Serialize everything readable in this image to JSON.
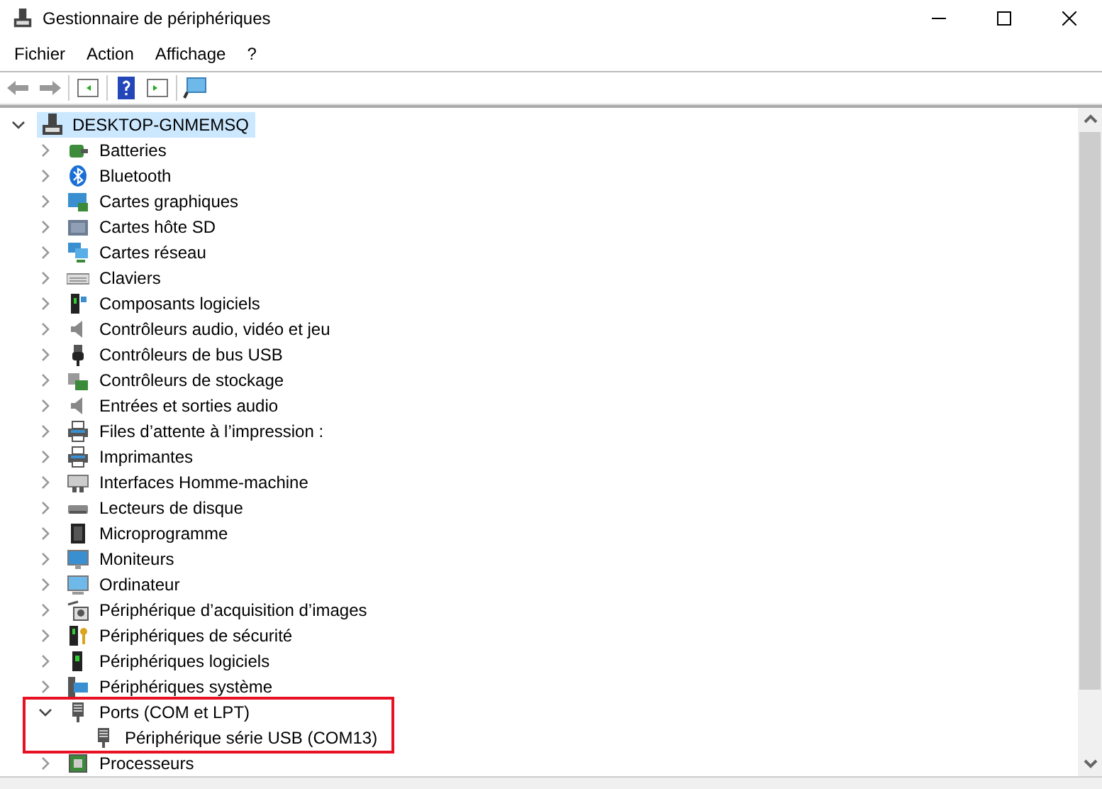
{
  "window": {
    "title": "Gestionnaire de périphériques"
  },
  "menu": [
    "Fichier",
    "Action",
    "Affichage",
    "?"
  ],
  "tree": {
    "label": "DESKTOP-GNMEMSQ",
    "selected": true,
    "expanded": true,
    "children": [
      {
        "label": "Batteries",
        "expanded": false,
        "highlighted": false
      },
      {
        "label": "Bluetooth",
        "expanded": false,
        "highlighted": false
      },
      {
        "label": "Cartes graphiques",
        "expanded": false,
        "highlighted": false
      },
      {
        "label": "Cartes hôte SD",
        "expanded": false,
        "highlighted": false
      },
      {
        "label": "Cartes réseau",
        "expanded": false,
        "highlighted": false
      },
      {
        "label": "Claviers",
        "expanded": false,
        "highlighted": false
      },
      {
        "label": "Composants logiciels",
        "expanded": false,
        "highlighted": false
      },
      {
        "label": "Contrôleurs audio, vidéo et jeu",
        "expanded": false,
        "highlighted": false
      },
      {
        "label": "Contrôleurs de bus USB",
        "expanded": false,
        "highlighted": false
      },
      {
        "label": "Contrôleurs de stockage",
        "expanded": false,
        "highlighted": false
      },
      {
        "label": "Entrées et sorties audio",
        "expanded": false,
        "highlighted": false
      },
      {
        "label": "Files d’attente à l’impression :",
        "expanded": false,
        "highlighted": false
      },
      {
        "label": "Imprimantes",
        "expanded": false,
        "highlighted": false
      },
      {
        "label": "Interfaces Homme-machine",
        "expanded": false,
        "highlighted": false
      },
      {
        "label": "Lecteurs de disque",
        "expanded": false,
        "highlighted": false
      },
      {
        "label": "Microprogramme",
        "expanded": false,
        "highlighted": false
      },
      {
        "label": "Moniteurs",
        "expanded": false,
        "highlighted": false
      },
      {
        "label": "Ordinateur",
        "expanded": false,
        "highlighted": false
      },
      {
        "label": "Périphérique d’acquisition d’images",
        "expanded": false,
        "highlighted": false
      },
      {
        "label": "Périphériques de sécurité",
        "expanded": false,
        "highlighted": false
      },
      {
        "label": "Périphériques logiciels",
        "expanded": false,
        "highlighted": false
      },
      {
        "label": "Périphériques système",
        "expanded": false,
        "highlighted": false
      },
      {
        "label": "Ports (COM et LPT)",
        "expanded": true,
        "highlighted": true,
        "children": [
          {
            "label": "Périphérique série USB (COM13)"
          }
        ]
      },
      {
        "label": "Processeurs",
        "expanded": false,
        "highlighted": false
      }
    ]
  }
}
